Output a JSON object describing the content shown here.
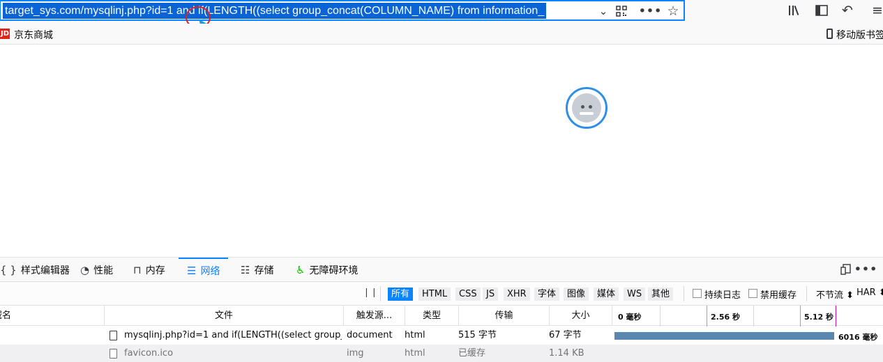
{
  "urlbar": {
    "url": "target_sys.com/mysqlinj.php?id=1 and if(LENGTH((select group_concat(COLUMN_NAME) from information_"
  },
  "toolbar_icons": [
    "chevron-down-icon",
    "qr-code-icon",
    "more-icon",
    "bookmark-star-icon",
    "library-icon",
    "sidebar-icon",
    "back-arrow-icon",
    "menu-icon"
  ],
  "bookmarks": {
    "jd_badge": "JD",
    "jd_label": "京东商城",
    "mobile_label": "移动版书签"
  },
  "devtools": {
    "tabs": [
      {
        "label": "样式编辑器",
        "icon": "{ }"
      },
      {
        "label": "性能",
        "icon": "◔"
      },
      {
        "label": "内存",
        "icon": "⊓"
      },
      {
        "label": "网络",
        "icon": "☰"
      },
      {
        "label": "存储",
        "icon": "☷"
      },
      {
        "label": "无障碍环境",
        "icon": "♿"
      }
    ],
    "filter": {
      "pause": "❘❘",
      "types": [
        "所有",
        "HTML",
        "CSS",
        "JS",
        "XHR",
        "字体",
        "图像",
        "媒体",
        "WS",
        "其他"
      ],
      "persist_logs": "持续日志",
      "disable_cache": "禁用缓存",
      "throttle": "不节流 ⬍",
      "har": "HAR ⬍"
    },
    "columns": {
      "domain": "域名",
      "file": "文件",
      "cause": "触发源...",
      "type": "类型",
      "transferred": "传输",
      "size": "大小"
    },
    "timeline_ticks": [
      "0 毫秒",
      "2.56 秒",
      "5.12 秒"
    ],
    "rows": [
      {
        "file": "mysqlinj.php?id=1 and if(LENGTH((select group_...",
        "cause": "document",
        "type": "html",
        "transferred": "515 字节",
        "size": "67 字节",
        "timing": "6016 毫秒"
      },
      {
        "file": "favicon.ico",
        "cause": "img",
        "type": "html",
        "transferred": "已缓存",
        "size": "1.14 KB",
        "timing": ""
      }
    ]
  }
}
